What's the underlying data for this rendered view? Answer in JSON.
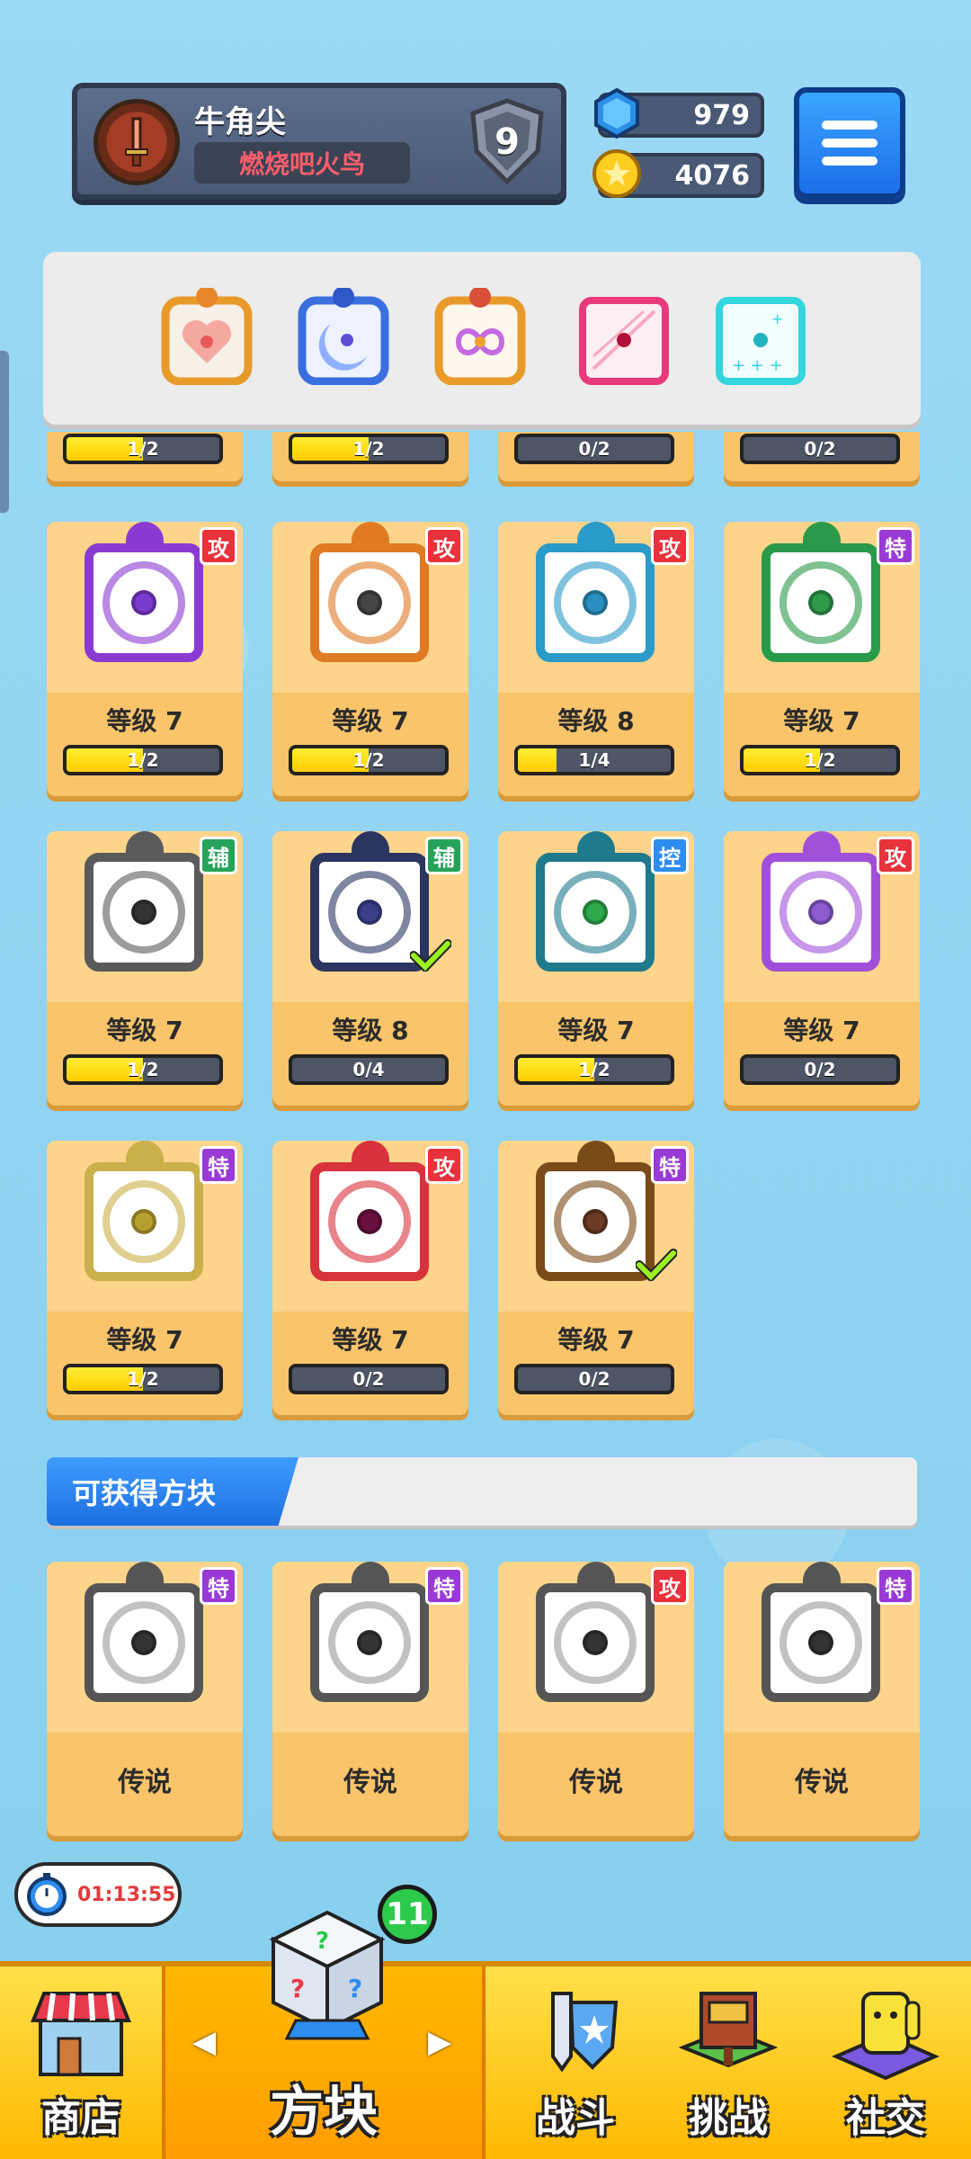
{
  "profile": {
    "name": "牛角尖",
    "title": "燃烧吧火鸟",
    "rank": "9"
  },
  "currency": {
    "gems": "979",
    "coins": "4076"
  },
  "deck": {
    "slots": [
      {
        "icon": "heart-block-icon",
        "color": "#ffcf6a"
      },
      {
        "icon": "moon-block-icon",
        "color": "#3b6fe0"
      },
      {
        "icon": "infinity-block-icon",
        "color": "#e8a33a"
      },
      {
        "icon": "pink-dot-block-icon",
        "color": "#e8397a"
      },
      {
        "icon": "cyan-plus-block-icon",
        "color": "#33d6dc"
      }
    ]
  },
  "partial_row": [
    {
      "progress": "1/2",
      "fill": 0.5
    },
    {
      "progress": "1/2",
      "fill": 0.5
    },
    {
      "progress": "0/2",
      "fill": 0
    },
    {
      "progress": "0/2",
      "fill": 0
    }
  ],
  "owned_blocks": [
    {
      "icon": "purple-flower-block-icon",
      "tag": "攻",
      "tag_type": "red",
      "level": "等级 7",
      "progress": "1/2",
      "fill": 0.5,
      "frame": "#8b3ad1",
      "pip": "#7a3bd1",
      "checked": false
    },
    {
      "icon": "gun-block-icon",
      "tag": "攻",
      "tag_type": "red",
      "level": "等级 7",
      "progress": "1/2",
      "fill": 0.5,
      "frame": "#e07a25",
      "pip": "#444444",
      "checked": false
    },
    {
      "icon": "vortex-block-icon",
      "tag": "攻",
      "tag_type": "red",
      "level": "等级 8",
      "progress": "1/4",
      "fill": 0.25,
      "frame": "#2a9ac8",
      "pip": "#2a8fc0",
      "checked": false
    },
    {
      "icon": "green-wind-block-icon",
      "tag": "特",
      "tag_type": "purple",
      "level": "等级 7",
      "progress": "1/2",
      "fill": 0.5,
      "frame": "#2a9a4a",
      "pip": "#2e9a4a",
      "checked": false
    },
    {
      "icon": "dial-block-icon",
      "tag": "辅",
      "tag_type": "green",
      "level": "等级 7",
      "progress": "1/2",
      "fill": 0.5,
      "frame": "#5a5a5a",
      "pip": "#333333",
      "checked": false
    },
    {
      "icon": "dark-moon-block-icon",
      "tag": "辅",
      "tag_type": "green",
      "level": "等级 8",
      "progress": "0/4",
      "fill": 0,
      "frame": "#2b3560",
      "pip": "#3a3f8a",
      "checked": true
    },
    {
      "icon": "wave-block-icon",
      "tag": "控",
      "tag_type": "blue",
      "level": "等级 7",
      "progress": "1/2",
      "fill": 0.5,
      "frame": "#1f7a8c",
      "pip": "#2ea84a",
      "checked": false
    },
    {
      "icon": "star-block-icon",
      "tag": "攻",
      "tag_type": "red",
      "level": "等级 7",
      "progress": "0/2",
      "fill": 0,
      "frame": "#a050d8",
      "pip": "#8e5ad0",
      "checked": false
    },
    {
      "icon": "sun-block-icon",
      "tag": "特",
      "tag_type": "purple",
      "level": "等级 7",
      "progress": "1/2",
      "fill": 0.5,
      "frame": "#c9b04a",
      "pip": "#b8a030",
      "checked": false
    },
    {
      "icon": "blade-block-icon",
      "tag": "攻",
      "tag_type": "red",
      "level": "等级 7",
      "progress": "0/2",
      "fill": 0,
      "frame": "#d8323c",
      "pip": "#6a1040",
      "checked": false
    },
    {
      "icon": "brown-heart-block-icon",
      "tag": "特",
      "tag_type": "purple",
      "level": "等级 7",
      "progress": "0/2",
      "fill": 0,
      "frame": "#7a4a18",
      "pip": "#6a3a22",
      "checked": true
    }
  ],
  "section": {
    "title": "可获得方块"
  },
  "obtainable_blocks": [
    {
      "icon": "pentagram-block-icon",
      "tag": "特",
      "tag_type": "purple",
      "rarity": "传说"
    },
    {
      "icon": "mist-block-icon",
      "tag": "特",
      "tag_type": "purple",
      "rarity": "传说"
    },
    {
      "icon": "combo-block-icon",
      "tag": "攻",
      "tag_type": "red",
      "rarity": "传说"
    },
    {
      "icon": "glitch-block-icon",
      "tag": "特",
      "tag_type": "purple",
      "rarity": "传说"
    }
  ],
  "timer": {
    "value": "01:13:55"
  },
  "nav": {
    "shop": "商店",
    "blocks": "方块",
    "battle": "战斗",
    "challenge": "挑战",
    "social": "社交",
    "blocks_badge": "11"
  }
}
